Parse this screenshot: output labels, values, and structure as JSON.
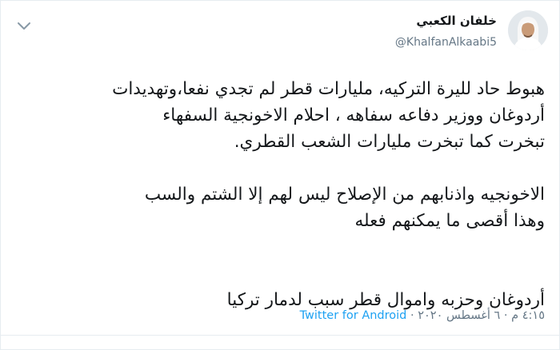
{
  "author": {
    "display_name": "خلفان الكعبي",
    "handle": "@KhalfanAlkaabi5"
  },
  "tweet": {
    "lines": [
      "هبوط حاد لليرة التركيه، مليارات قطر لم تجدي نفعا،وتهديدات",
      "أردوغان ووزير دفاعه سفاهه ، احلام الاخونجية السفهاء",
      "تبخرت كما تبخرت مليارات الشعب القطري.",
      "",
      "الاخونجيه واذنابهم من الإصلاح  ليس لهم إلا الشتم والسب",
      "وهذا أقصى ما يمكنهم فعله",
      "",
      "أردوغان وحزبه واموال قطر سبب لدمار تركيا"
    ]
  },
  "meta": {
    "time_date": "٤:١٥ م · ٦ أغسطس ٢٠٢٠ · ",
    "source": "Twitter for Android"
  },
  "icons": {
    "menu": "chevron-down-icon",
    "avatar": "avatar-photo"
  },
  "colors": {
    "accent": "#1da1f2",
    "text": "#14171a",
    "muted": "#657786"
  }
}
